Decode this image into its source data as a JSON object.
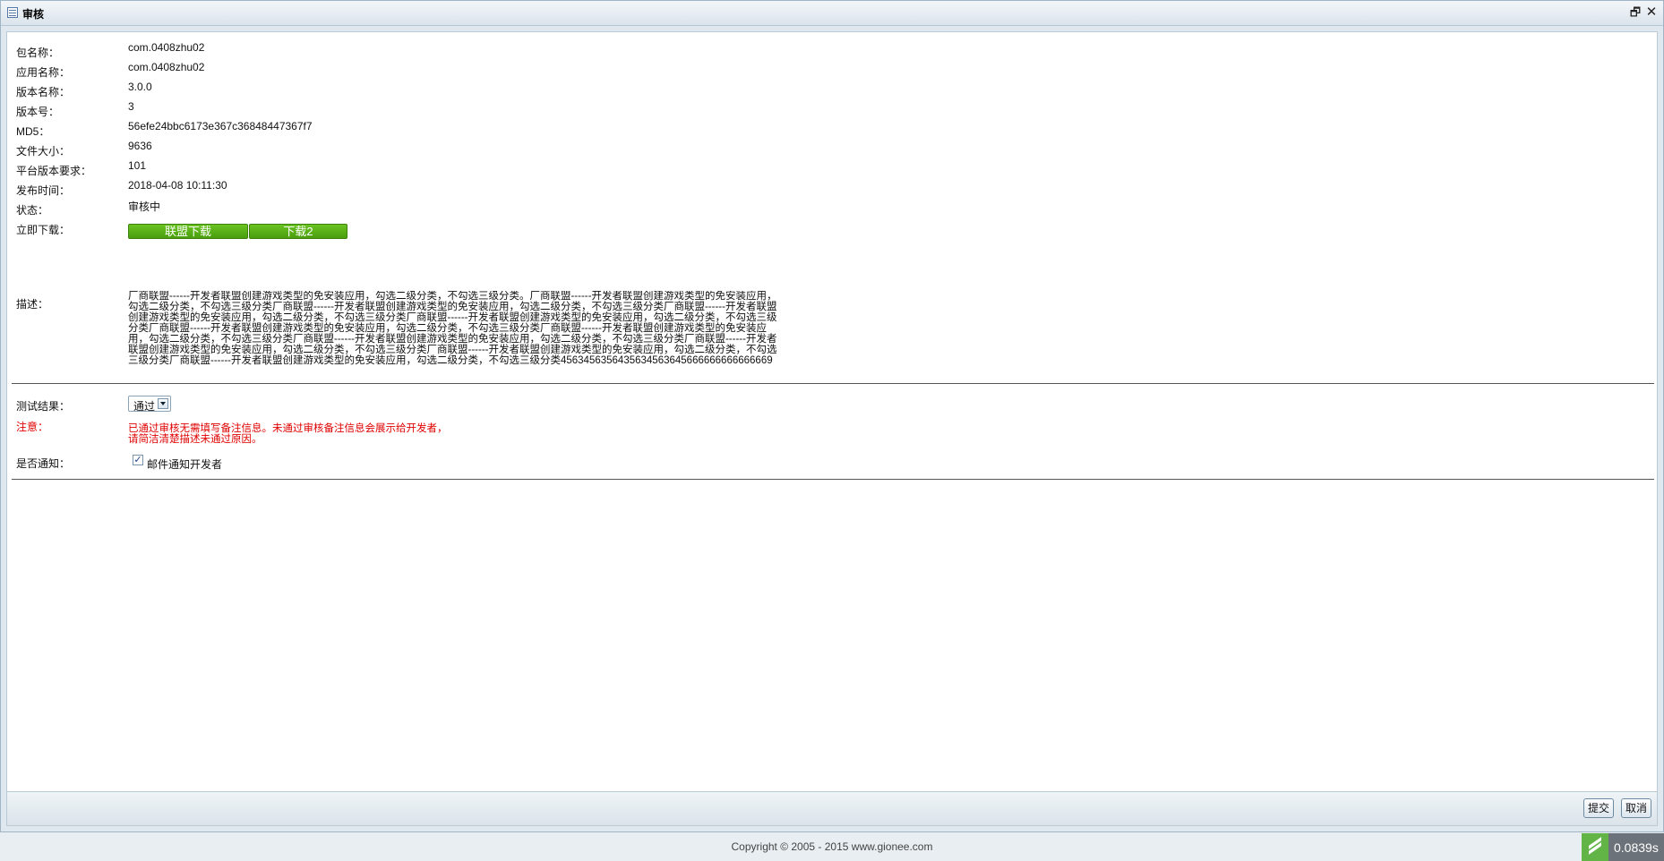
{
  "window": {
    "title": "审核"
  },
  "fields": [
    {
      "label": "包名称：",
      "value": "com.0408zhu02"
    },
    {
      "label": "应用名称：",
      "value": "com.0408zhu02"
    },
    {
      "label": "版本名称：",
      "value": "3.0.0"
    },
    {
      "label": "版本号：",
      "value": "3"
    },
    {
      "label": "MD5：",
      "value": "56efe24bbc6173e367c36848447367f7"
    },
    {
      "label": "文件大小：",
      "value": "9636"
    },
    {
      "label": "平台版本要求：",
      "value": "101"
    },
    {
      "label": "发布时间：",
      "value": "2018-04-08 10:11:30"
    },
    {
      "label": "状态：",
      "value": "审核中"
    }
  ],
  "download": {
    "label": "立即下载：",
    "btn1": "联盟下载",
    "btn2": "下载2"
  },
  "description": {
    "label": "描述：",
    "text": "厂商联盟------开发者联盟创建游戏类型的免安装应用，勾选二级分类，不勾选三级分类。厂商联盟------开发者联盟创建游戏类型的免安装应用，勾选二级分类，不勾选三级分类厂商联盟------开发者联盟创建游戏类型的免安装应用，勾选二级分类，不勾选三级分类厂商联盟------开发者联盟创建游戏类型的免安装应用，勾选二级分类，不勾选三级分类厂商联盟------开发者联盟创建游戏类型的免安装应用，勾选二级分类，不勾选三级分类厂商联盟------开发者联盟创建游戏类型的免安装应用，勾选二级分类，不勾选三级分类厂商联盟------开发者联盟创建游戏类型的免安装应用，勾选二级分类，不勾选三级分类厂商联盟------开发者联盟创建游戏类型的免安装应用，勾选二级分类，不勾选三级分类厂商联盟------开发者联盟创建游戏类型的免安装应用，勾选二级分类，不勾选三级分类厂商联盟------开发者联盟创建游戏类型的免安装应用，勾选二级分类，不勾选三级分类厂商联盟------开发者联盟创建游戏类型的免安装应用，勾选二级分类，不勾选三级分类4563456356435634563645666666666666669"
  },
  "test_result": {
    "label": "测试结果：",
    "selected": "通过"
  },
  "notice": {
    "label": "注意：",
    "line1": "已通过审核无需填写备注信息。未通过审核备注信息会展示给开发者，",
    "line2": "请简洁清楚描述未通过原因。"
  },
  "notify": {
    "label": "是否通知：",
    "checkbox_label": "邮件通知开发者",
    "checked": "✓"
  },
  "buttons": {
    "submit": "提交",
    "cancel": "取消"
  },
  "footer": {
    "copyright": "Copyright © 2005 - 2015 www.gionee.com",
    "timer": "0.0839s"
  },
  "colors": {
    "download_green": "#4a9e0e",
    "notice_red": "#e00000"
  }
}
